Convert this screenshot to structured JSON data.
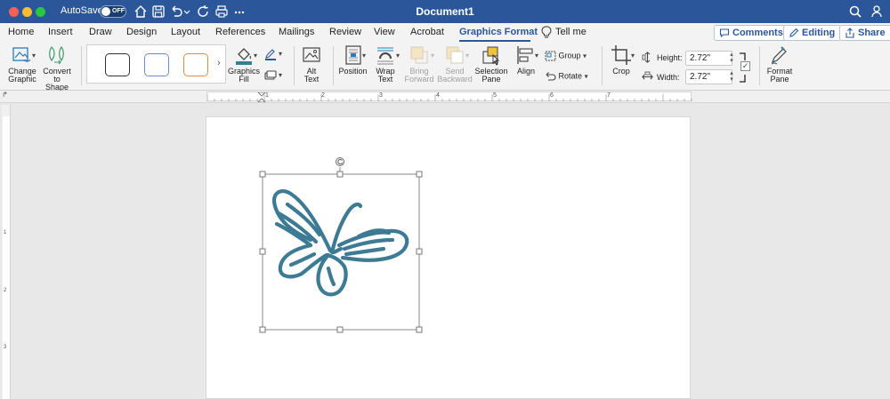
{
  "titlebar": {
    "autosave_label": "AutoSave",
    "autosave_state": "OFF",
    "document_title": "Document1"
  },
  "tabs": [
    {
      "label": "Home"
    },
    {
      "label": "Insert"
    },
    {
      "label": "Draw"
    },
    {
      "label": "Design"
    },
    {
      "label": "Layout"
    },
    {
      "label": "References"
    },
    {
      "label": "Mailings"
    },
    {
      "label": "Review"
    },
    {
      "label": "View"
    },
    {
      "label": "Acrobat"
    },
    {
      "label": "Graphics Format",
      "active": true
    },
    {
      "label": "Tell me"
    }
  ],
  "actions": {
    "comments": "Comments",
    "editing": "Editing",
    "share": "Share"
  },
  "ribbon": {
    "change_graphic": "Change Graphic",
    "convert_to_shape": "Convert to Shape",
    "graphics_fill": "Graphics Fill",
    "alt_text": "Alt Text",
    "position": "Position",
    "wrap_text": "Wrap Text",
    "bring_forward": "Bring Forward",
    "send_backward": "Send Backward",
    "selection_pane": "Selection Pane",
    "align": "Align",
    "group": "Group",
    "rotate": "Rotate",
    "crop": "Crop",
    "height_label": "Height:",
    "height_value": "2.72\"",
    "width_label": "Width:",
    "width_value": "2.72\"",
    "format_pane": "Format Pane"
  },
  "ruler": {
    "numbers": [
      "1",
      "2",
      "3",
      "4",
      "5",
      "6",
      "7"
    ]
  },
  "colors": {
    "brand_blue": "#2b579a",
    "graphic_stroke": "#3d7a94"
  }
}
